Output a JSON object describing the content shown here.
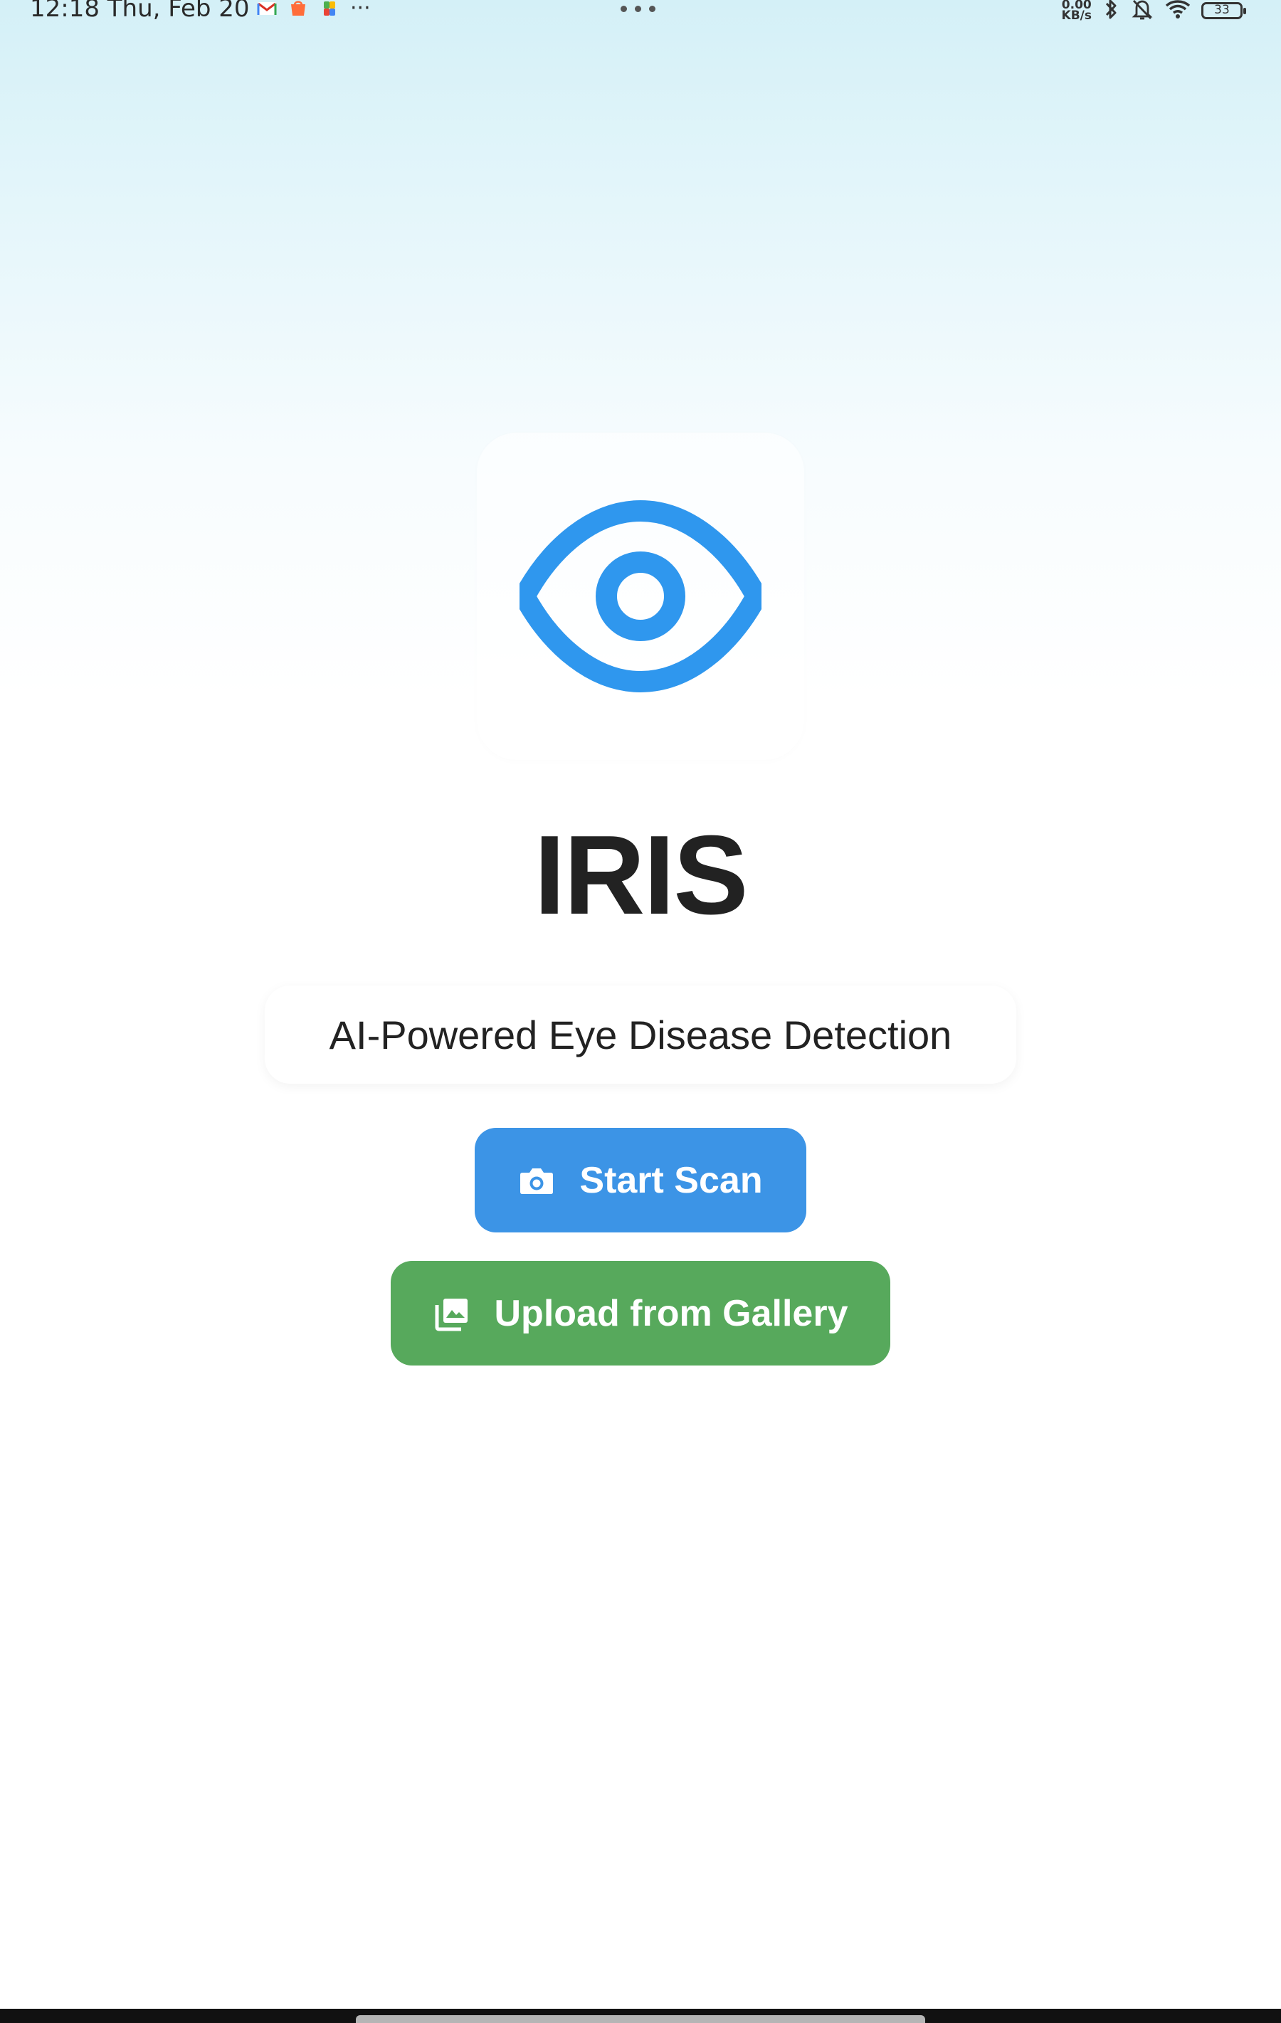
{
  "status_bar": {
    "time_date": "12:18  Thu, Feb 20",
    "notification_icons": [
      "gmail-icon",
      "shopping-app-icon",
      "colorful-app-icon"
    ],
    "more_notifications": "···",
    "network_speed_value": "0.00",
    "network_speed_unit": "KB/s",
    "status_icons": [
      "bluetooth-icon",
      "bell-off-icon",
      "wifi-icon"
    ],
    "battery": "33"
  },
  "app": {
    "logo_icon": "eye-icon",
    "title": "IRIS",
    "subtitle": "AI-Powered Eye Disease Detection"
  },
  "actions": {
    "scan_label": "Start Scan",
    "scan_icon": "camera-icon",
    "gallery_label": "Upload from Gallery",
    "gallery_icon": "photo-library-icon"
  },
  "colors": {
    "primary": "#3c94e6",
    "eye_blue": "#2f97ee",
    "success": "#57a95c",
    "text": "#222222"
  }
}
